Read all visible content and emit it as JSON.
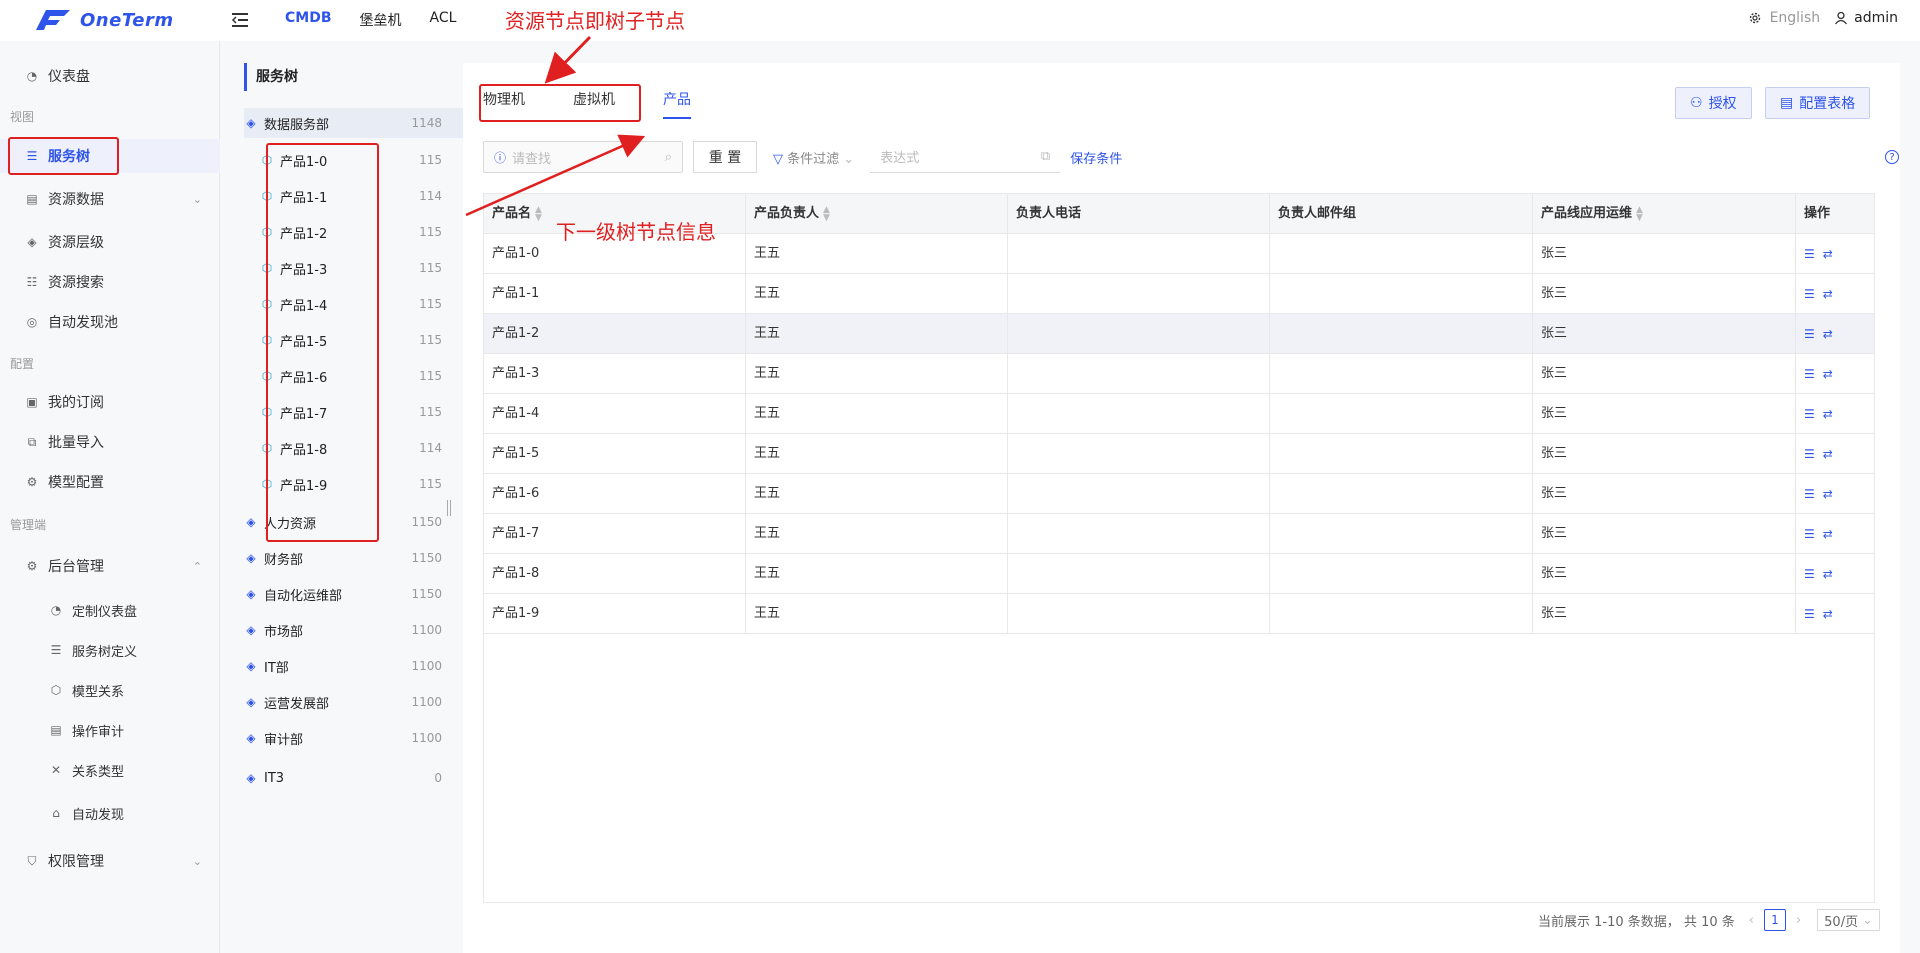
{
  "header": {
    "logo_text": "OneTerm",
    "nav": [
      "CMDB",
      "堡垒机",
      "ACL"
    ],
    "lang": "English",
    "user": "admin"
  },
  "sidebar": {
    "items": [
      {
        "label": "仪表盘"
      },
      {
        "label": "服务树"
      },
      {
        "label": "资源数据"
      },
      {
        "label": "资源层级"
      },
      {
        "label": "资源搜索"
      },
      {
        "label": "自动发现池"
      },
      {
        "label": "我的订阅"
      },
      {
        "label": "批量导入"
      },
      {
        "label": "模型配置"
      },
      {
        "label": "后台管理"
      },
      {
        "label": "定制仪表盘"
      },
      {
        "label": "服务树定义"
      },
      {
        "label": "模型关系"
      },
      {
        "label": "操作审计"
      },
      {
        "label": "关系类型"
      },
      {
        "label": "自动发现"
      },
      {
        "label": "权限管理"
      }
    ],
    "sections": [
      "视图",
      "配置",
      "管理端"
    ]
  },
  "tree": {
    "title": "服务树",
    "root": {
      "label": "数据服务部",
      "count": "1148"
    },
    "children": [
      {
        "label": "产品1-0",
        "count": "115"
      },
      {
        "label": "产品1-1",
        "count": "114"
      },
      {
        "label": "产品1-2",
        "count": "115"
      },
      {
        "label": "产品1-3",
        "count": "115"
      },
      {
        "label": "产品1-4",
        "count": "115"
      },
      {
        "label": "产品1-5",
        "count": "115"
      },
      {
        "label": "产品1-6",
        "count": "115"
      },
      {
        "label": "产品1-7",
        "count": "115"
      },
      {
        "label": "产品1-8",
        "count": "114"
      },
      {
        "label": "产品1-9",
        "count": "115"
      }
    ],
    "others": [
      {
        "label": "人力资源",
        "count": "1150"
      },
      {
        "label": "财务部",
        "count": "1150"
      },
      {
        "label": "自动化运维部",
        "count": "1150"
      },
      {
        "label": "市场部",
        "count": "1100"
      },
      {
        "label": "IT部",
        "count": "1100"
      },
      {
        "label": "运营发展部",
        "count": "1100"
      },
      {
        "label": "审计部",
        "count": "1100"
      },
      {
        "label": "IT3",
        "count": "0"
      }
    ]
  },
  "main": {
    "tabs": [
      "物理机",
      "虚拟机",
      "产品"
    ],
    "buttons": {
      "grant": "授权",
      "config_table": "配置表格"
    },
    "search_placeholder": "请查找",
    "reset": "重 置",
    "condition_filter": "条件过滤",
    "expr_placeholder": "表达式",
    "save_condition": "保存条件",
    "columns": [
      "产品名",
      "产品负责人",
      "负责人电话",
      "负责人邮件组",
      "产品线应用运维",
      "操作"
    ],
    "rows": [
      [
        "产品1-0",
        "王五",
        "",
        "",
        "张三"
      ],
      [
        "产品1-1",
        "王五",
        "",
        "",
        "张三"
      ],
      [
        "产品1-2",
        "王五",
        "",
        "",
        "张三"
      ],
      [
        "产品1-3",
        "王五",
        "",
        "",
        "张三"
      ],
      [
        "产品1-4",
        "王五",
        "",
        "",
        "张三"
      ],
      [
        "产品1-5",
        "王五",
        "",
        "",
        "张三"
      ],
      [
        "产品1-6",
        "王五",
        "",
        "",
        "张三"
      ],
      [
        "产品1-7",
        "王五",
        "",
        "",
        "张三"
      ],
      [
        "产品1-8",
        "王五",
        "",
        "",
        "张三"
      ],
      [
        "产品1-9",
        "王五",
        "",
        "",
        "张三"
      ]
    ],
    "pager": {
      "summary": "当前展示 1-10 条数据， 共 10 条",
      "current": "1",
      "page_size": "50/页"
    }
  },
  "annotations": {
    "top": "资源节点即树子节点",
    "middle": "下一级树节点信息"
  },
  "colors": {
    "accent": "#2f54eb",
    "annotation": "#e02020"
  }
}
